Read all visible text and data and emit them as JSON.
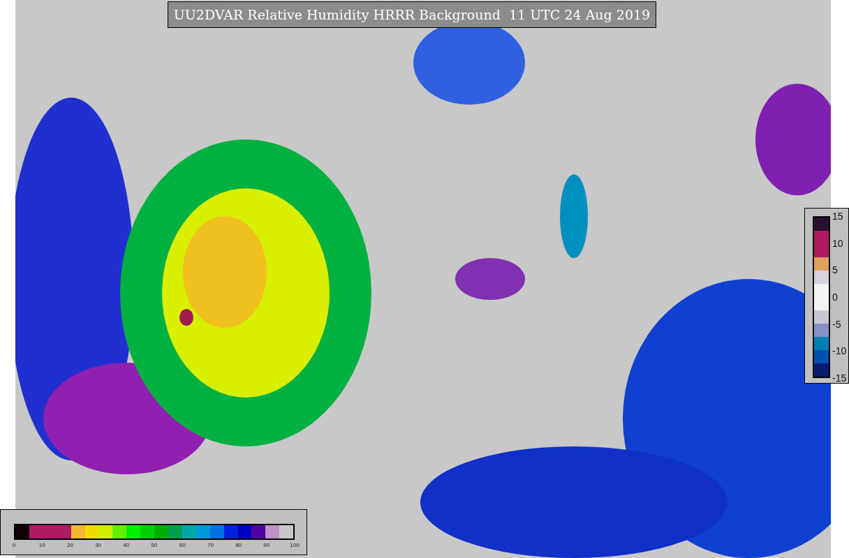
{
  "title": "UU2DVAR Relative Humidity HRRR Background  11 UTC 24 Aug 2019",
  "humidity_colorbar": {
    "segments": [
      {
        "color": "#100008"
      },
      {
        "color": "#b01c64"
      },
      {
        "color": "#b01c64"
      },
      {
        "color": "#b01c64"
      },
      {
        "color": "#f2b830"
      },
      {
        "color": "#f0dc00"
      },
      {
        "color": "#d0f000"
      },
      {
        "color": "#60f000"
      },
      {
        "color": "#00f000"
      },
      {
        "color": "#00d000"
      },
      {
        "color": "#00b000"
      },
      {
        "color": "#00a050"
      },
      {
        "color": "#00a8a8"
      },
      {
        "color": "#0098d8"
      },
      {
        "color": "#0070e0"
      },
      {
        "color": "#0020e0"
      },
      {
        "color": "#0000c0"
      },
      {
        "color": "#5000a0"
      },
      {
        "color": "#c090c8"
      },
      {
        "color": "#c8c8c8"
      }
    ],
    "ticks": [
      "0",
      "10",
      "20",
      "30",
      "40",
      "50",
      "60",
      "70",
      "80",
      "90",
      "100"
    ]
  },
  "increment_colorbar": {
    "segments": [
      {
        "color": "#2a1030"
      },
      {
        "color": "#b01c64"
      },
      {
        "color": "#b01c64"
      },
      {
        "color": "#e0a060"
      },
      {
        "color": "#d8d0dc"
      },
      {
        "color": "#f4f4f4"
      },
      {
        "color": "#f4f4f4"
      },
      {
        "color": "#c8c8d4"
      },
      {
        "color": "#8890c8"
      },
      {
        "color": "#0080b0"
      },
      {
        "color": "#0050b0"
      },
      {
        "color": "#0a1c70"
      }
    ],
    "ticks": [
      "15",
      "10",
      "5",
      "0",
      "-5",
      "-10",
      "-15"
    ]
  }
}
